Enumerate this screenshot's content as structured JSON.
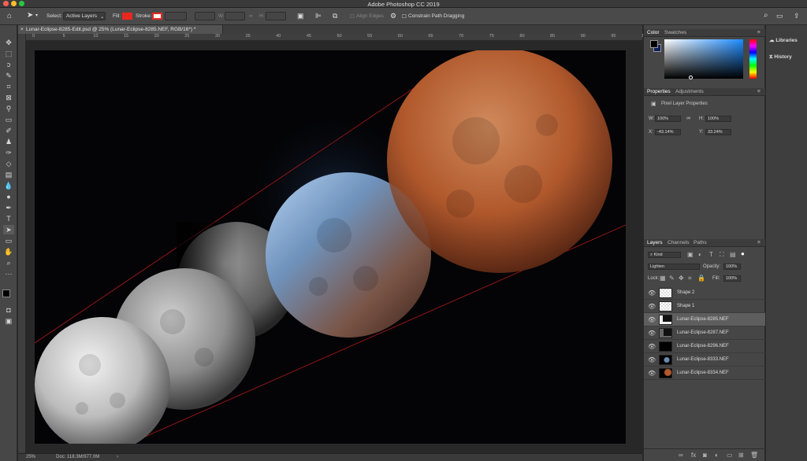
{
  "window": {
    "title": "Adobe Photoshop CC 2019"
  },
  "options_bar": {
    "select_label": "Select:",
    "select_value": "Active Layers",
    "fill_label": "Fill:",
    "stroke_label": "Stroke:",
    "w_label": "W:",
    "h_label": "H:",
    "align_edges": "Align Edges",
    "constrain_path": "Constrain Path Dragging"
  },
  "document_tab": {
    "label": "Lunar-Eclipse-8285-Edit.psd @ 25% (Lunar-Eclipse-8285.NEF, RGB/16*) *"
  },
  "ruler": {
    "marks": [
      "0",
      "5",
      "10",
      "15",
      "20",
      "25",
      "30",
      "35",
      "40",
      "45",
      "50",
      "55",
      "60",
      "65",
      "70",
      "75",
      "80",
      "85",
      "90",
      "95",
      "100"
    ]
  },
  "status": {
    "zoom": "25%",
    "doc": "Doc: 118.3M/977.0M"
  },
  "color_panel": {
    "tabs": [
      "Color",
      "Swatches"
    ]
  },
  "properties_panel": {
    "tabs": [
      "Properties",
      "Adjustments"
    ],
    "subtitle": "Pixel Layer Properties",
    "w_label": "W:",
    "w_value": "100%",
    "h_label": "H:",
    "h_value": "100%",
    "x_label": "X:",
    "x_value": "-43.14%",
    "y_label": "Y:",
    "y_value": "33.24%"
  },
  "layers_panel": {
    "tabs": [
      "Layers",
      "Channels",
      "Paths"
    ],
    "filter": "Kind",
    "blend_mode": "Lighten",
    "opacity_label": "Opacity:",
    "opacity_value": "100%",
    "lock_label": "Lock:",
    "fill_label": "Fill:",
    "fill_value": "100%",
    "layers": [
      {
        "name": "Shape 2"
      },
      {
        "name": "Shape 1"
      },
      {
        "name": "Lunar-Eclipse-8285.NEF"
      },
      {
        "name": "Lunar-Eclipse-8287.NEF"
      },
      {
        "name": "Lunar-Eclipse-8296.NEF"
      },
      {
        "name": "Lunar-Eclipse-8333.NEF"
      },
      {
        "name": "Lunar-Eclipse-8334.NEF"
      }
    ]
  },
  "dock": {
    "libraries": "Libraries",
    "history": "History"
  },
  "colors": {
    "fill": "#e8281e",
    "accent": "#1473e6",
    "selected_layer": "#5e5e5e"
  }
}
